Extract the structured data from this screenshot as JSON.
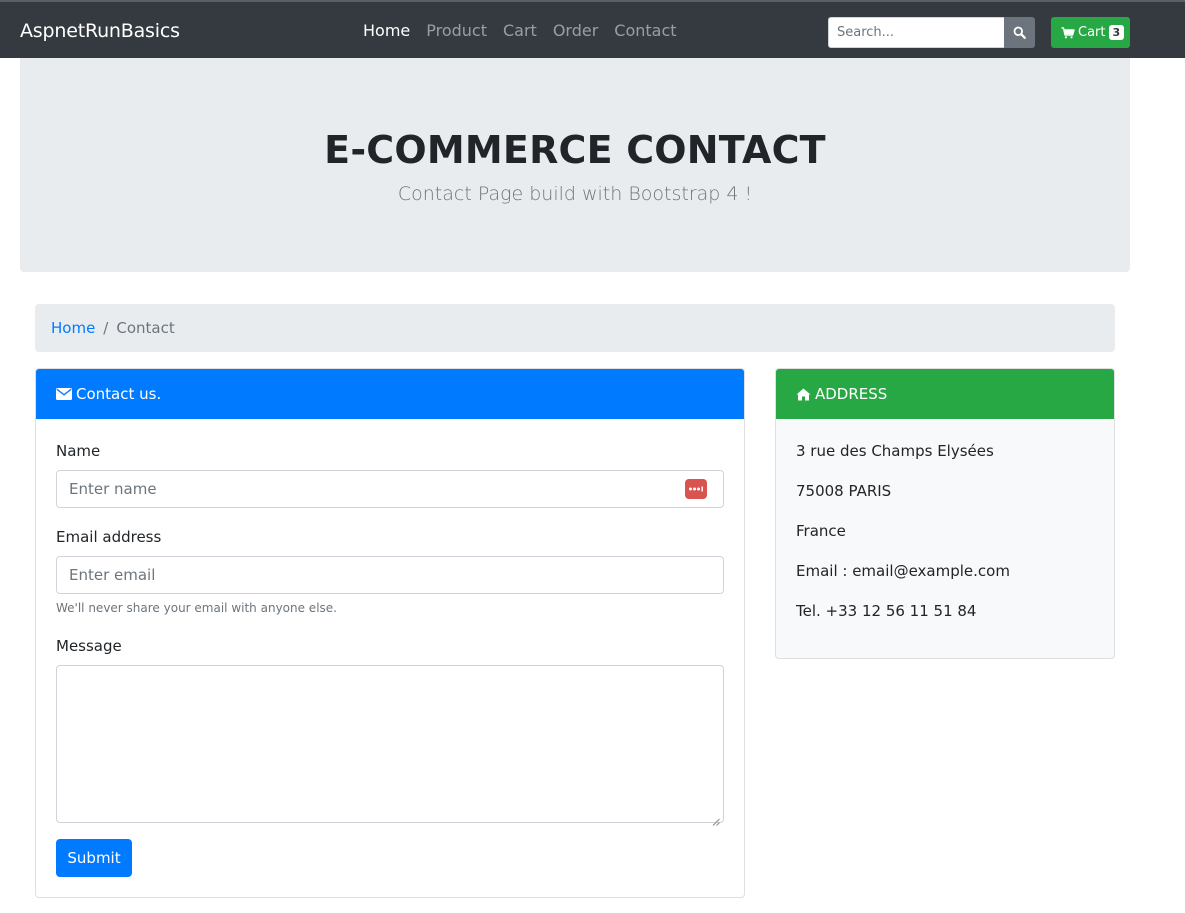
{
  "navbar": {
    "brand": "AspnetRunBasics",
    "links": [
      {
        "label": "Home"
      },
      {
        "label": "Product"
      },
      {
        "label": "Cart"
      },
      {
        "label": "Order"
      },
      {
        "label": "Contact"
      }
    ],
    "search_placeholder": "Search...",
    "cart_label": "Cart",
    "cart_count": "3"
  },
  "jumbotron": {
    "title": "E-COMMERCE CONTACT",
    "subtitle": "Contact Page build with Bootstrap 4 !"
  },
  "breadcrumb": {
    "home": "Home",
    "separator": "/",
    "current": "Contact"
  },
  "contact_card": {
    "header": "Contact us.",
    "name_label": "Name",
    "name_placeholder": "Enter name",
    "email_label": "Email address",
    "email_placeholder": "Enter email",
    "email_help": "We'll never share your email with anyone else.",
    "message_label": "Message",
    "submit_label": "Submit"
  },
  "address_card": {
    "header": "ADDRESS",
    "lines": [
      "3 rue des Champs Elysées",
      "75008 PARIS",
      "France",
      "Email : email@example.com",
      "Tel. +33 12 56 11 51 84"
    ]
  },
  "colors": {
    "navbar": "#343a40",
    "primary": "#007bff",
    "success": "#28a745",
    "jumbotron": "#e9ecef"
  }
}
